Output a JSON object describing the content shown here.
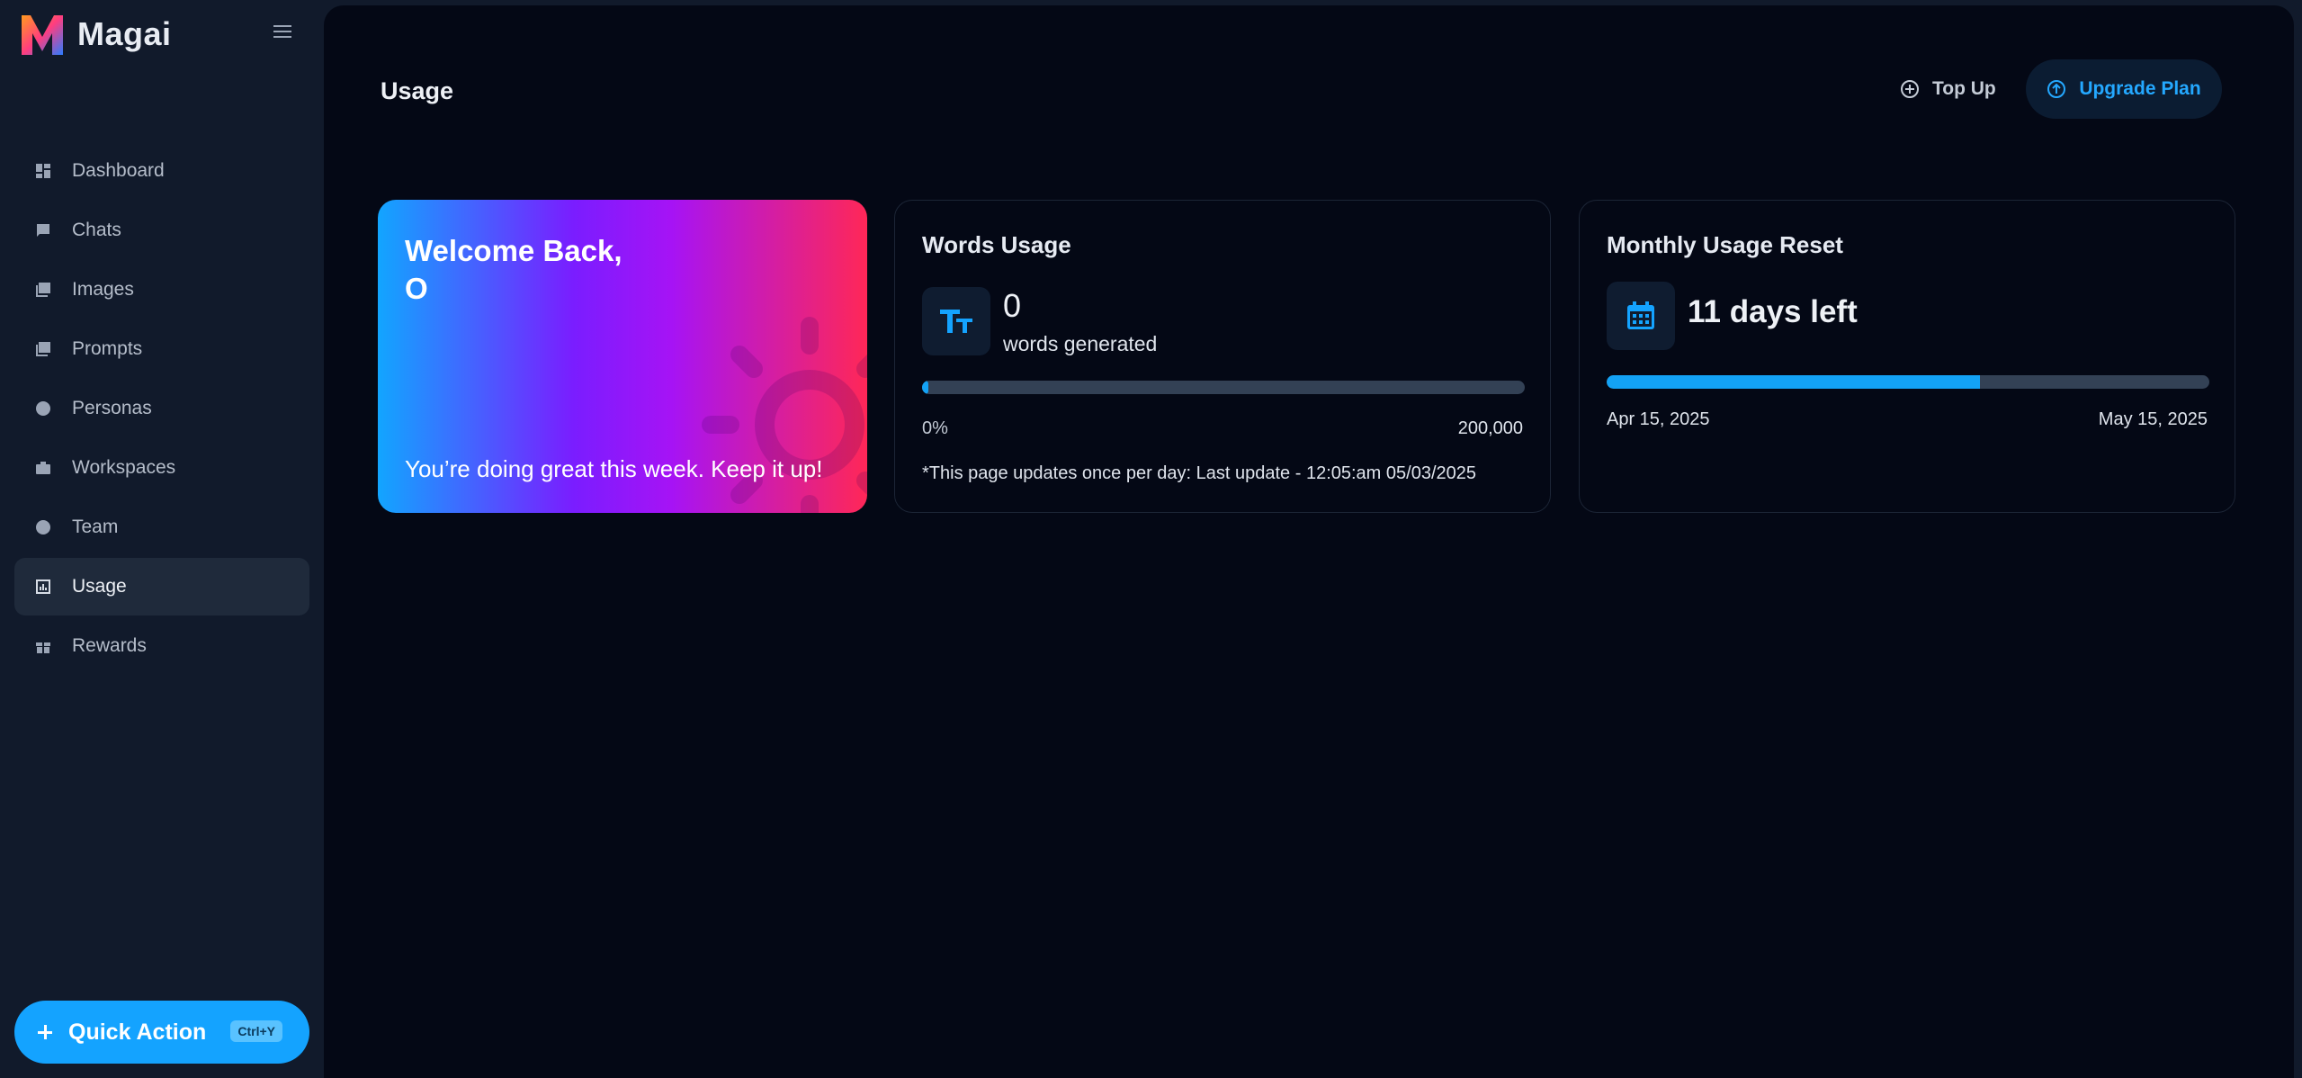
{
  "brand": {
    "name": "Magai"
  },
  "sidebar": {
    "items": [
      {
        "label": "Dashboard",
        "icon": "dashboard-icon"
      },
      {
        "label": "Chats",
        "icon": "chat-icon"
      },
      {
        "label": "Images",
        "icon": "images-icon"
      },
      {
        "label": "Prompts",
        "icon": "prompts-icon"
      },
      {
        "label": "Personas",
        "icon": "persona-icon"
      },
      {
        "label": "Workspaces",
        "icon": "briefcase-icon"
      },
      {
        "label": "Team",
        "icon": "team-icon"
      },
      {
        "label": "Usage",
        "icon": "usage-icon",
        "active": true
      },
      {
        "label": "Rewards",
        "icon": "gift-icon"
      }
    ],
    "quick_action": {
      "label": "Quick Action",
      "shortcut": "Ctrl+Y"
    }
  },
  "header": {
    "title": "Usage",
    "topup_label": "Top Up",
    "upgrade_label": "Upgrade Plan"
  },
  "welcome": {
    "title": "Welcome Back,",
    "name": "O",
    "message": "You’re doing great this week. Keep it up!"
  },
  "words_usage": {
    "title": "Words Usage",
    "value": "0",
    "unit_label": "words generated",
    "progress_percent": 1,
    "min_label": "0%",
    "max_label": "200,000",
    "note": "*This page updates once per day: Last update - 12:05:am 05/03/2025"
  },
  "monthly_reset": {
    "title": "Monthly Usage Reset",
    "days_left": "11 days left",
    "progress_percent": 62,
    "start_date": "Apr 15, 2025",
    "end_date": "May 15, 2025"
  },
  "colors": {
    "accent": "#14a3ff",
    "sidebar_bg": "#111a2b",
    "main_bg": "#040815"
  }
}
